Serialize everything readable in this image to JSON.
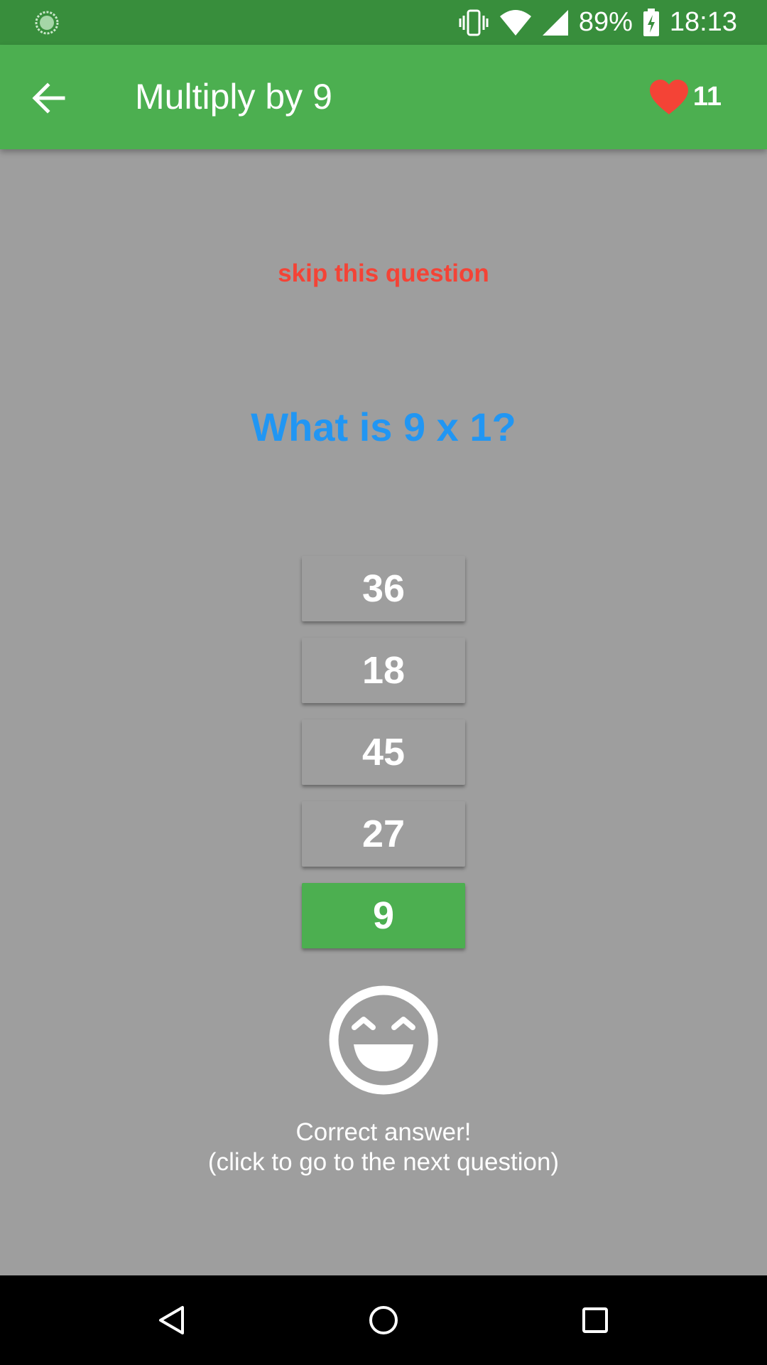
{
  "status_bar": {
    "battery_percent": "89%",
    "time": "18:13"
  },
  "app_bar": {
    "title": "Multiply by 9",
    "lives_count": "11"
  },
  "quiz": {
    "skip_label": "skip this question",
    "question": "What is 9 x 1?",
    "answers": [
      {
        "label": "36",
        "state": "default"
      },
      {
        "label": "18",
        "state": "default"
      },
      {
        "label": "45",
        "state": "default"
      },
      {
        "label": "27",
        "state": "default"
      },
      {
        "label": "9",
        "state": "correct"
      }
    ],
    "feedback_line1": "Correct answer!",
    "feedback_line2": "(click to go to the next question)"
  },
  "colors": {
    "status_bar": "#388e3c",
    "app_bar": "#4caf50",
    "background": "#9e9e9e",
    "skip": "#f44336",
    "question": "#2196f3",
    "correct_answer": "#4caf50",
    "heart": "#f44336"
  },
  "icons": {
    "status_left": "loading-indicator-icon",
    "vibrate": "vibrate-icon",
    "wifi": "wifi-icon",
    "signal": "cell-signal-icon",
    "battery": "battery-charging-icon",
    "back": "arrow-left-icon",
    "lives": "heart-icon",
    "feedback": "grinning-face-icon",
    "nav_back": "triangle-back-icon",
    "nav_home": "circle-home-icon",
    "nav_recents": "square-recents-icon"
  }
}
